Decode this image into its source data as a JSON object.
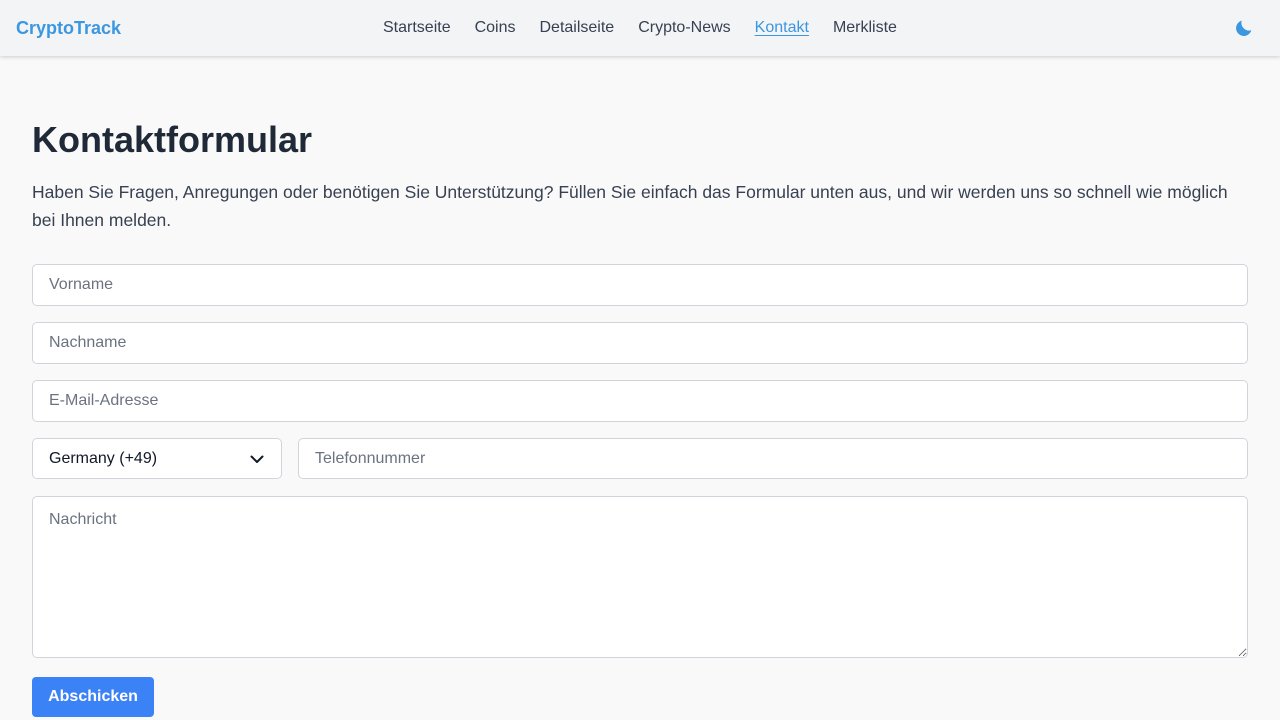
{
  "header": {
    "brand": "CryptoTrack",
    "nav": [
      {
        "label": "Startseite",
        "active": false
      },
      {
        "label": "Coins",
        "active": false
      },
      {
        "label": "Detailseite",
        "active": false
      },
      {
        "label": "Crypto-News",
        "active": false
      },
      {
        "label": "Kontakt",
        "active": true
      },
      {
        "label": "Merkliste",
        "active": false
      }
    ],
    "theme_toggle_icon": "moon-icon"
  },
  "main": {
    "title": "Kontaktformular",
    "intro": "Haben Sie Fragen, Anregungen oder benötigen Sie Unterstützung? Füllen Sie einfach das Formular unten aus, und wir werden uns so schnell wie möglich bei Ihnen melden."
  },
  "form": {
    "first_name": {
      "placeholder": "Vorname",
      "value": ""
    },
    "last_name": {
      "placeholder": "Nachname",
      "value": ""
    },
    "email": {
      "placeholder": "E-Mail-Adresse",
      "value": ""
    },
    "country": {
      "selected": "Germany (+49)",
      "icon": "chevron-down-icon"
    },
    "phone": {
      "placeholder": "Telefonnummer",
      "value": ""
    },
    "message": {
      "placeholder": "Nachricht",
      "value": ""
    },
    "submit_label": "Abschicken"
  },
  "colors": {
    "accent": "#3b97e0",
    "button": "#3b82f6",
    "background": "#f9f9f9",
    "header_bg": "#f3f4f6"
  }
}
